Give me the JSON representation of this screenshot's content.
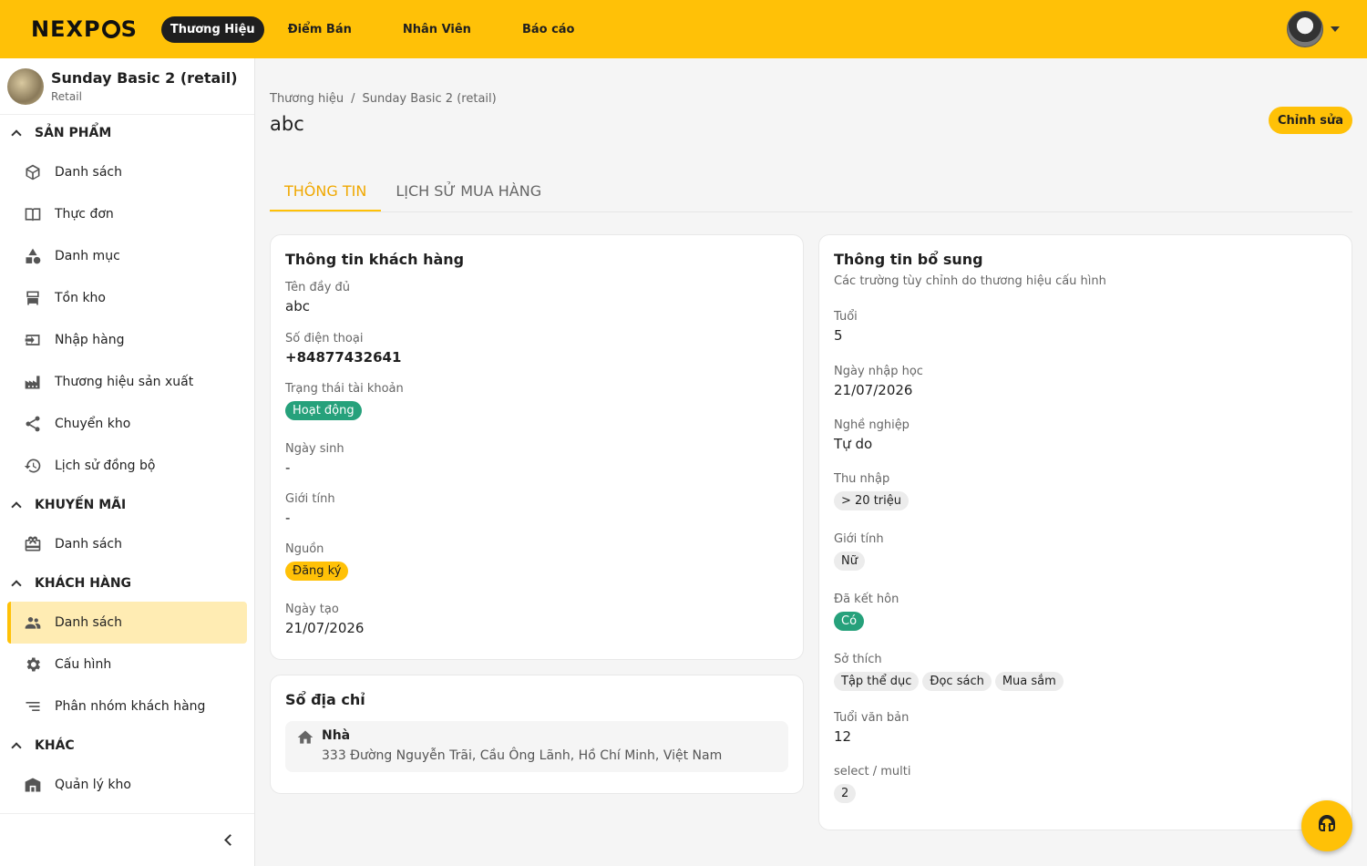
{
  "app": {
    "logo": "NEXPOS",
    "nav": [
      "Thương Hiệu",
      "Điểm Bán",
      "Nhân Viên",
      "Báo cáo"
    ],
    "accent_color": "#ffc107"
  },
  "sidebar": {
    "store_name": "Sunday Basic 2 (retail)",
    "store_type": "Retail",
    "sections": [
      {
        "title": "SẢN PHẨM",
        "items": [
          {
            "label": "Danh sách",
            "icon": "cube-icon"
          },
          {
            "label": "Thực đơn",
            "icon": "book-icon"
          },
          {
            "label": "Danh mục",
            "icon": "category-icon"
          },
          {
            "label": "Tồn kho",
            "icon": "inventory-icon"
          },
          {
            "label": "Nhập hàng",
            "icon": "import-icon"
          },
          {
            "label": "Thương hiệu sản xuất",
            "icon": "factory-icon"
          },
          {
            "label": "Chuyển kho",
            "icon": "share-icon"
          },
          {
            "label": "Lịch sử đồng bộ",
            "icon": "history-icon"
          }
        ]
      },
      {
        "title": "KHUYẾN MÃI",
        "items": [
          {
            "label": "Danh sách",
            "icon": "gift-icon"
          }
        ]
      },
      {
        "title": "KHÁCH HÀNG",
        "items": [
          {
            "label": "Danh sách",
            "icon": "people-icon",
            "active": true
          },
          {
            "label": "Cấu hình",
            "icon": "gear-icon"
          },
          {
            "label": "Phân nhóm khách hàng",
            "icon": "sort-icon"
          }
        ]
      },
      {
        "title": "KHÁC",
        "items": [
          {
            "label": "Quản lý kho",
            "icon": "warehouse-icon"
          }
        ]
      }
    ]
  },
  "main": {
    "breadcrumb": [
      "Thương hiệu",
      "Sunday Basic 2 (retail)"
    ],
    "breadcrumb_sep": "/",
    "title": "abc",
    "edit_label": "Chỉnh sửa",
    "tabs": [
      "THÔNG TIN",
      "LỊCH SỬ MUA HÀNG"
    ],
    "customer_info": {
      "title": "Thông tin khách hàng",
      "full_name_label": "Tên đầy đủ",
      "full_name": "abc",
      "phone_label": "Số điện thoại",
      "phone": "+84877432641",
      "status_label": "Trạng thái tài khoản",
      "status": "Hoạt động",
      "dob_label": "Ngày sinh",
      "dob": "-",
      "gender_label": "Giới tính",
      "gender": "-",
      "source_label": "Nguồn",
      "source": "Đăng ký",
      "created_label": "Ngày tạo",
      "created": "21/07/2026"
    },
    "address_book": {
      "title": "Sổ địa chỉ",
      "name": "Nhà",
      "address": "333 Đường Nguyễn Trãi, Cầu Ông Lãnh, Hồ Chí Minh, Việt Nam"
    },
    "extra_info": {
      "title": "Thông tin bổ sung",
      "subtitle": "Các trường tùy chỉnh do thương hiệu cấu hình",
      "age_label": "Tuổi",
      "age": "5",
      "enroll_label": "Ngày nhập học",
      "enroll": "21/07/2026",
      "job_label": "Nghề nghiệp",
      "job": "Tự do",
      "income_label": "Thu nhập",
      "income": "> 20 triệu",
      "gender_label": "Giới tính",
      "gender": "Nữ",
      "married_label": "Đã kết hôn",
      "married": "Có",
      "hobby_label": "Sở thích",
      "hobbies": [
        "Tập thể dục",
        "Đọc sách",
        "Mua sắm"
      ],
      "text_age_label": "Tuổi văn bản",
      "text_age": "12",
      "select_label": "select / multi",
      "select": "2"
    }
  }
}
